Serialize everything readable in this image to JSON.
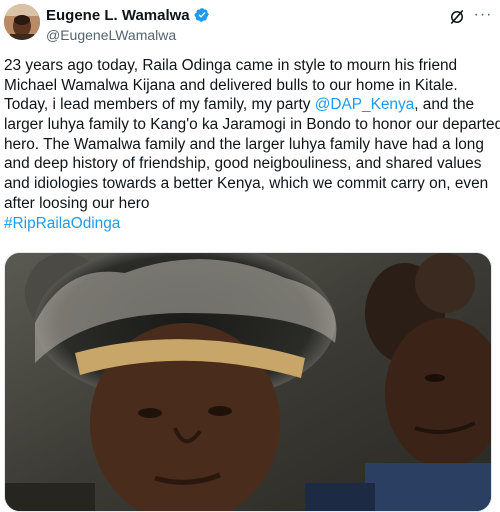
{
  "author": {
    "display_name": "Eugene L. Wamalwa",
    "handle": "@EugeneLWamalwa",
    "verified": true,
    "avatar_icon": "profile-photo"
  },
  "actions": {
    "grok_icon": "grok-icon",
    "more_label": "···"
  },
  "tweet": {
    "line1": "23 years ago today, Raila Odinga came in style to mourn his friend",
    "line2": "Michael Wamalwa Kijana and delivered bulls to our home in Kitale.",
    "line3_pre": "Today, i lead members of my family, my party ",
    "mention": "@DAP_Kenya",
    "line3_post": ", and the",
    "line4": "larger luhya family to Kang'o ka Jaramogi in Bondo to honor our departed",
    "line5": "hero. The Wamalwa family and the larger luhya family have had a long",
    "line6": "and deep history of friendship, good neigbouliness, and shared values",
    "line7": "and idiologies towards a better Kenya, which we commit carry on, even",
    "line8": "after loosing our hero",
    "hashtag": "#RipRailaOdinga"
  },
  "colors": {
    "text": "#0f1419",
    "secondary": "#536471",
    "accent": "#1d9bf0"
  }
}
